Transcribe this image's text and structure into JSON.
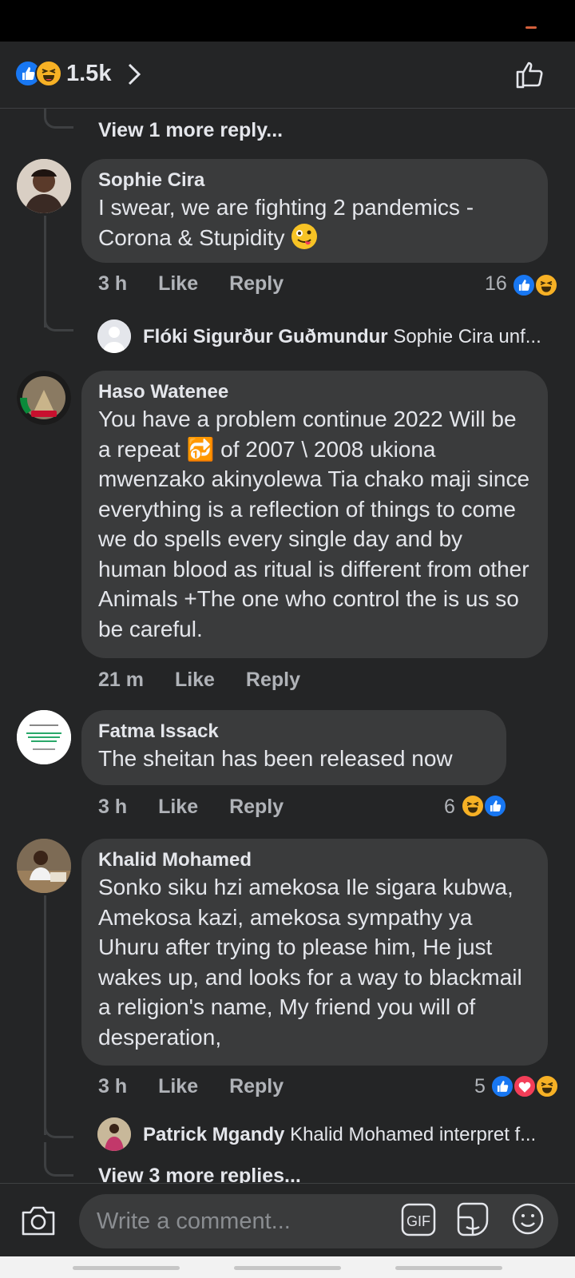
{
  "reactions_header": {
    "count": "1.5k",
    "icons": [
      "like-icon",
      "haha-icon"
    ],
    "chevron": "chevron-right-icon",
    "action_icon": "thumbs-up-outline-icon"
  },
  "top_thread": {
    "more_replies": "View 1 more reply..."
  },
  "comments": [
    {
      "author": "Sophie Cira",
      "text": "I swear, we are fighting 2 pandemics - Corona & Stupidity",
      "time": "3 h",
      "like": "Like",
      "reply": "Reply",
      "reaction_count": "16",
      "reactions": [
        "like-icon",
        "haha-icon"
      ],
      "reply_preview": {
        "name": "Flóki Sigurður Guðmundur",
        "text": "Sophie Cira unf..."
      }
    },
    {
      "author": "Haso Watenee",
      "text": "You have a problem continue 2022 Will be a repeat 🔂 of 2007 \\ 2008 ukiona mwenzako akinyolewa Tia chako maji since everything is a reflection of things to come we do spells every single day and by human blood as ritual is different from other Animals +The one who control the is  us so be careful.",
      "time": "21 m",
      "like": "Like",
      "reply": "Reply"
    },
    {
      "author": "Fatma Issack",
      "text": "The sheitan has been released now",
      "time": "3 h",
      "like": "Like",
      "reply": "Reply",
      "reaction_count": "6",
      "reactions": [
        "haha-icon",
        "like-icon"
      ]
    },
    {
      "author": "Khalid Mohamed",
      "text": "Sonko siku hzi amekosa Ile sigara kubwa, Amekosa kazi, amekosa sympathy ya Uhuru after trying to please him, He just wakes up, and looks for a way to blackmail a religion's name, My friend you will of desperation,",
      "time": "3 h",
      "like": "Like",
      "reply": "Reply",
      "reaction_count": "5",
      "reactions": [
        "like-icon",
        "love-icon",
        "haha-icon"
      ],
      "reply_preview": {
        "name": "Patrick Mgandy",
        "text": "Khalid Mohamed interpret f..."
      },
      "more_replies": "View 3 more replies..."
    }
  ],
  "composer": {
    "placeholder": "Write a comment...",
    "gif_label": "GIF",
    "icons": [
      "camera-icon",
      "gif-icon",
      "sticker-icon",
      "emoji-icon"
    ]
  },
  "colors": {
    "background": "#242526",
    "bubble": "#3a3b3c",
    "like": "#1877f2",
    "haha": "#f7b125",
    "love": "#f33e58"
  }
}
